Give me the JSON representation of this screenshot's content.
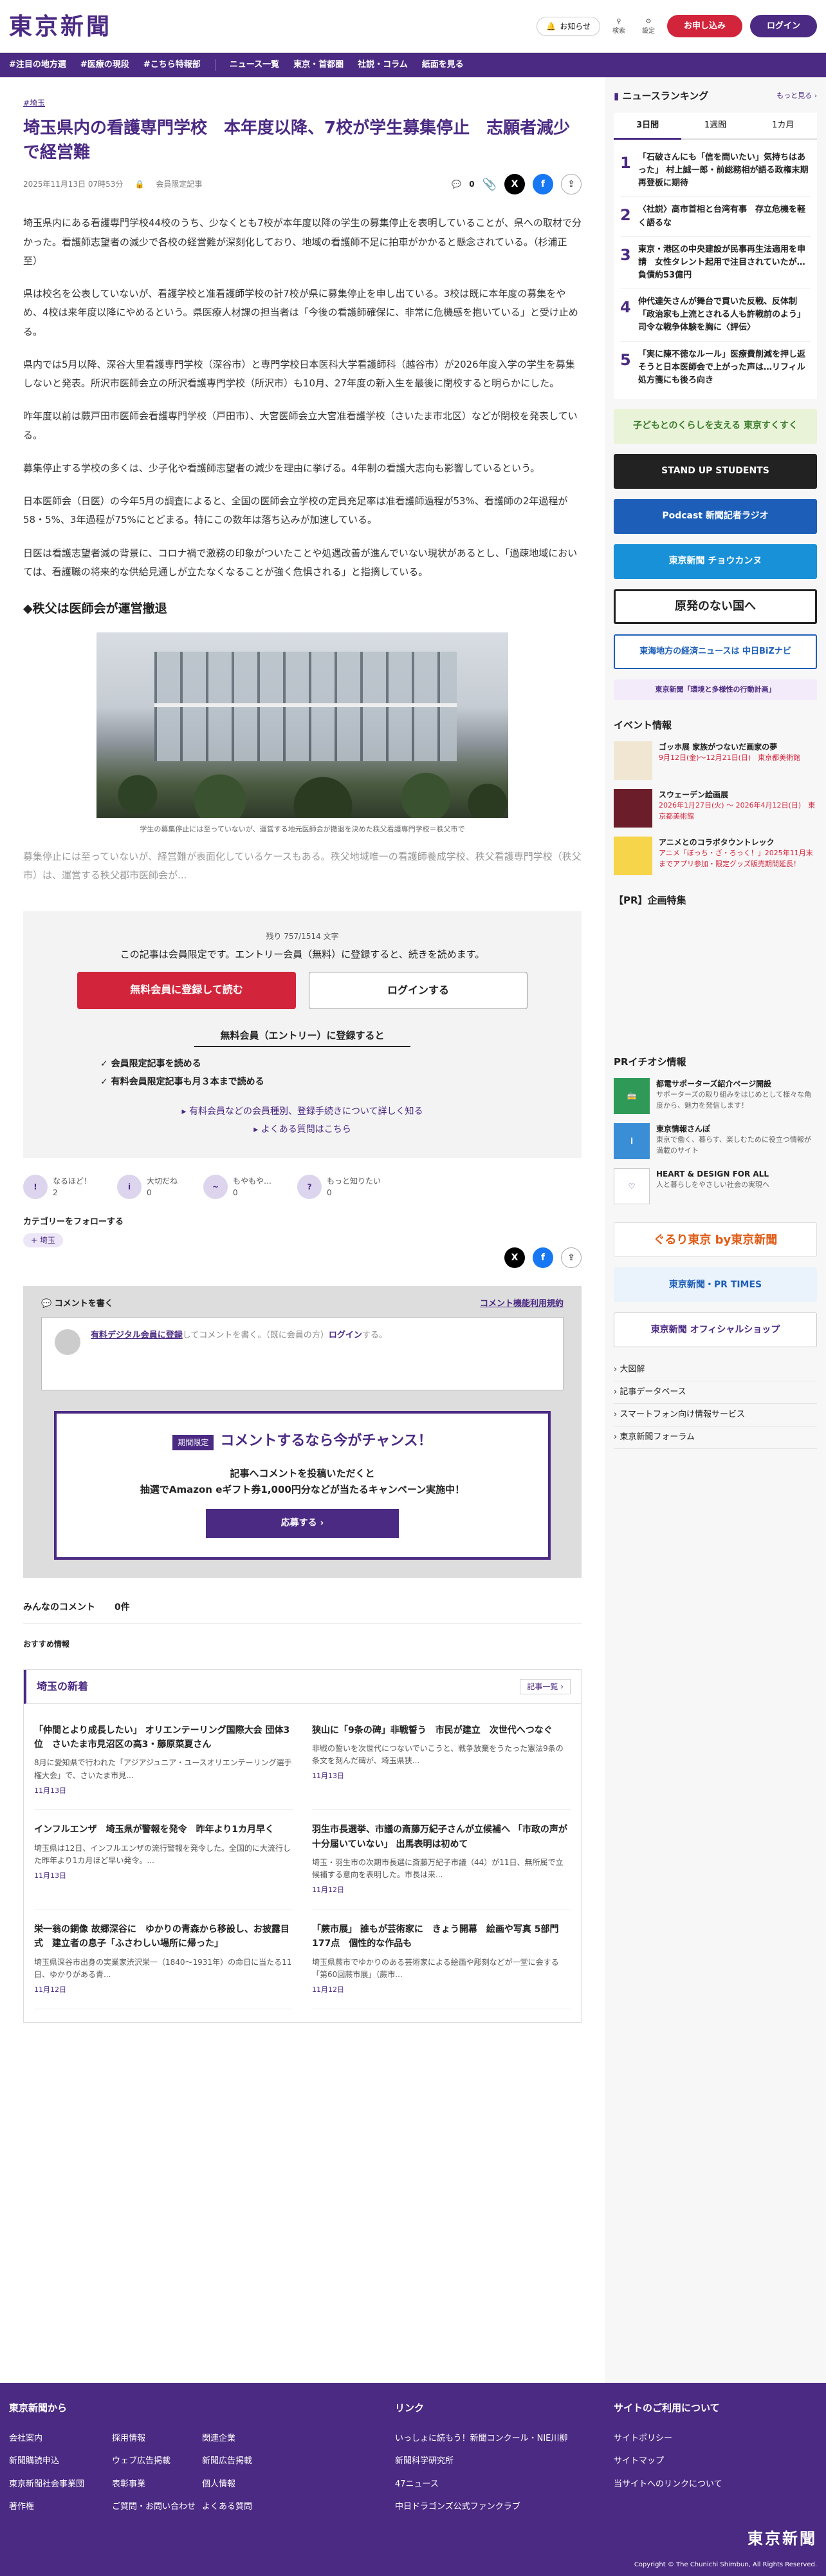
{
  "header": {
    "logo": "東京新聞",
    "notice": "お知らせ",
    "search": "検索",
    "settings": "設定",
    "apply": "お申し込み",
    "login": "ログイン"
  },
  "nav": {
    "items": [
      "#注目の地方選",
      "#医療の現段",
      "#こちら特報部",
      "ニュース一覧",
      "東京・首都圏",
      "社説・コラム",
      "紙面を見る"
    ]
  },
  "article": {
    "tag": "#埼玉",
    "title": "埼玉県内の看護専門学校　本年度以降、7校が学生募集停止　志願者減少で経営難",
    "date": "2025年11月13日 07時53分",
    "member": "会員限定記事",
    "comment_count": "0",
    "paragraphs": [
      "埼玉県内にある看護専門学校44校のうち、少なくとも7校が本年度以降の学生の募集停止を表明していることが、県への取材で分かった。看護師志望者の減少で各校の経営難が深刻化しており、地域の看護師不足に拍車がかかると懸念されている。（杉浦正至）",
      "県は校名を公表していないが、看護学校と准看護師学校の計7校が県に募集停止を申し出ている。3校は既に本年度の募集をやめ、4校は来年度以降にやめるという。県医療人材課の担当者は「今後の看護師確保に、非常に危機感を抱いている」と受け止める。",
      "県内では5月以降、深谷大里看護専門学校（深谷市）と専門学校日本医科大学看護師科（越谷市）が2026年度入学の学生を募集しないと発表。所沢市医師会立の所沢看護専門学校（所沢市）も10月、27年度の新入生を最後に閉校すると明らかにした。",
      "昨年度以前は蕨戸田市医師会看護専門学校（戸田市）、大宮医師会立大宮准看護学校（さいたま市北区）などが閉校を発表している。",
      "募集停止する学校の多くは、少子化や看護師志望者の減少を理由に挙げる。4年制の看護大志向も影響しているという。",
      "日本医師会（日医）の今年5月の調査によると、全国の医師会立学校の定員充足率は准看護師過程が53%、看護師の2年過程が58・5%、3年過程が75%にとどまる。特にこの数年は落ち込みが加速している。",
      "日医は看護志望者減の背景に、コロナ禍で激務の印象がついたことや処遇改善が進んでいない現状があるとし、「過疎地域においては、看護職の将来的な供給見通しが立たなくなることが強く危惧される」と指摘している。"
    ],
    "subhead": "◆秩父は医師会が運営撤退",
    "caption": "学生の募集停止には至っていないが、運営する地元医師会が撤退を決めた秩父看護専門学校＝秩父市で",
    "fade": "募集停止には至っていないが、経営難が表面化しているケースもある。秩父地域唯一の看護師養成学校、秩父看護専門学校（秩父市）は、運営する秩父郡市医師会が..."
  },
  "paywall": {
    "remain": "残り 757/1514 文字",
    "msg": "この記事は会員限定です。エントリー会員（無料）に登録すると、続きを読めます。",
    "register": "無料会員に登録して読む",
    "login": "ログインする",
    "head": "無料会員（エントリー）に登録すると",
    "benefits": [
      "✓ 会員限定記事を読める",
      "✓ 有料会員限定記事も月３本まで読める"
    ],
    "link1": "▸ 有料会員などの会員種別、登録手続きについて詳しく知る",
    "link2": "▸ よくある質問はこちら"
  },
  "reactions": [
    {
      "label": "なるほど！",
      "count": "2",
      "icon": "!"
    },
    {
      "label": "大切だね",
      "count": "0",
      "icon": "i"
    },
    {
      "label": "もやもや…",
      "count": "0",
      "icon": "~"
    },
    {
      "label": "もっと知りたい",
      "count": "0",
      "icon": "?"
    }
  ],
  "follow": {
    "label": "カテゴリーをフォローする",
    "chip": "+ 埼玉"
  },
  "comments": {
    "write": "コメントを書く",
    "rules": "コメント機能利用規約",
    "prompt_link": "有料デジタル会員に登録",
    "prompt_text": "してコメントを書く。（既に会員の方）",
    "prompt_login": "ログイン",
    "prompt_end": "する。",
    "promo_limited": "期間限定",
    "promo_title": "コメントするなら今がチャンス！",
    "promo_sub1": "記事へコメントを投稿いただくと",
    "promo_sub2": "抽選でAmazon eギフト券1,000円分などが当たるキャンペーン実施中！",
    "promo_btn": "応募する ›",
    "all": "みんなのコメント",
    "all_count": "0件"
  },
  "recommend": "おすすめ情報",
  "news": {
    "title": "埼玉の新着",
    "more": "記事一覧 ›",
    "items": [
      {
        "t": "「仲間とより成長したい」 オリエンテーリング国際大会 団体3位　さいたま市見沼区の高3・藤原菜夏さん",
        "b": "8月に愛知県で行われた「アジアジュニア・ユースオリエンテーリング選手権大会」で、さいたま市見...",
        "d": "11月13日"
      },
      {
        "t": "狭山に「9条の碑」非戦誓う　市民が建立　次世代へつなぐ",
        "b": "非戦の誓いを次世代につないでいこうと、戦争放棄をうたった憲法9条の条文を刻んだ碑が、埼玉県狭...",
        "d": "11月13日"
      },
      {
        "t": "インフルエンザ　埼玉県が警報を発令　昨年より1カ月早く",
        "b": "埼玉県は12日、インフルエンザの流行警報を発令した。全国的に大流行した昨年より1カ月ほど早い発令。...",
        "d": "11月13日"
      },
      {
        "t": "羽生市長選挙、市議の斎藤万紀子さんが立候補へ 「市政の声が十分届いていない」 出馬表明は初めて",
        "b": "埼玉・羽生市の次期市長選に斎藤万紀子市議（44）が11日、無所属で立候補する意向を表明した。市長は来...",
        "d": "11月12日"
      },
      {
        "t": "栄一翁の銅像 故郷深谷に　ゆかりの青森から移設し、お披露目式　建立者の息子「ふさわしい場所に帰った」",
        "b": "埼玉県深谷市出身の実業家渋沢栄一（1840～1931年）の命日に当たる11日、ゆかりがある青...",
        "d": "11月12日"
      },
      {
        "t": "「蕨市展」 誰もが芸術家に　きょう開幕　絵画や写真 5部門177点　個性的な作品も",
        "b": "埼玉県蕨市でゆかりのある芸術家による絵画や彫刻などが一堂に会する「第60回蕨市展」（蕨市...",
        "d": "11月12日"
      }
    ]
  },
  "sidebar": {
    "ranking_title": "ニュースランキング",
    "ranking_more": "もっと見る ›",
    "tabs": [
      "3日間",
      "1週間",
      "1カ月"
    ],
    "ranking": [
      "「石破さんにも「信を問いたい」気持ちはあった」 村上誠一郎・前総務相が語る政権末期　再登板に期待",
      "〈社説〉高市首相と台湾有事　存立危機を軽く語るな",
      "東京・港区の中央建設が民事再生法適用を申請　女性タレント起用で注目されていたが…負債約53億円",
      "仲代達矢さんが舞台で貫いた反戦、反体制「政治家も上流とされる人も許戦前のよう」 司令な戦争体験を胸に〈評伝〉",
      "「実に陳不徳なルール」医療費削減を押し返そうと日本医師会で上がった声は…リフィル処方箋にも後ろ向き"
    ],
    "banners": [
      "子どもとのくらしを支える 東京すくすく",
      "STAND UP STUDENTS",
      "Podcast 新聞記者ラジオ",
      "東京新聞 チョウカンヌ",
      "原発のない国へ",
      "東海地方の経済ニュースは 中日BiZナビ",
      "東京新聞「環境と多様性の行動計画」"
    ],
    "event_title": "イベント情報",
    "events": [
      {
        "t": "ゴッホ展 家族がつないだ画家の夢",
        "d": "9月12日(金)～12月21日(日)　東京都美術館"
      },
      {
        "t": "スウェーデン絵画展",
        "d": "2026年1月27日(火) ～ 2026年4月12日(日)　東京都美術館"
      },
      {
        "t": "アニメとのコラボタウントレック",
        "d": "アニメ「ぼっち・ざ・ろっく！」2025年11月末までアプリ参加・限定グッズ販売期間延長！"
      }
    ],
    "pr_title": "【PR】企画特集",
    "pr2_title": "PRイチオシ情報",
    "pr_items": [
      {
        "t": "都電サポーターズ紹介ページ開設",
        "b": "サポーターズの取り組みをはじめとして様々な角度から、魅力を発信します！"
      },
      {
        "t": "東京情報さんぽ",
        "b": "東京で働く、暮らす、楽しむために役立つ情報が満載のサイト"
      },
      {
        "t": "HEART & DESIGN FOR ALL",
        "b": "人と暮らしをやさしい社会の実現へ"
      }
    ],
    "banners2": [
      "ぐるり東京 by東京新聞",
      "東京新聞・PR TIMES",
      "東京新聞 オフィシャルショップ"
    ],
    "links": [
      "› 大図解",
      "› 記事データベース",
      "› スマートフォン向け情報サービス",
      "› 東京新聞フォーラム"
    ]
  },
  "footer": {
    "col1": "東京新聞から",
    "col2": "リンク",
    "col3": "サイトのご利用について",
    "c1": [
      "会社案内",
      "採用情報",
      "関連企業",
      "新聞購読申込",
      "ウェブ広告掲載",
      "新聞広告掲載",
      "東京新聞社会事業団",
      "表彰事業",
      "個人情報",
      "著作権",
      "ご質問・お問い合わせ",
      "よくある質問"
    ],
    "c2": [
      "いっしょに読もう！新聞コンクール・NIE川柳",
      "新聞科学研究所",
      "47ニュース",
      "中日ドラゴンズ公式ファンクラブ"
    ],
    "c3": [
      "サイトポリシー",
      "サイトマップ",
      "当サイトへのリンクについて"
    ],
    "logo": "東京新聞",
    "copy": "Copyright © The Chunichi Shimbun, All Rights Reserved."
  },
  "colors": {
    "brand": "#4b2a83",
    "accent": "#d2243b"
  }
}
